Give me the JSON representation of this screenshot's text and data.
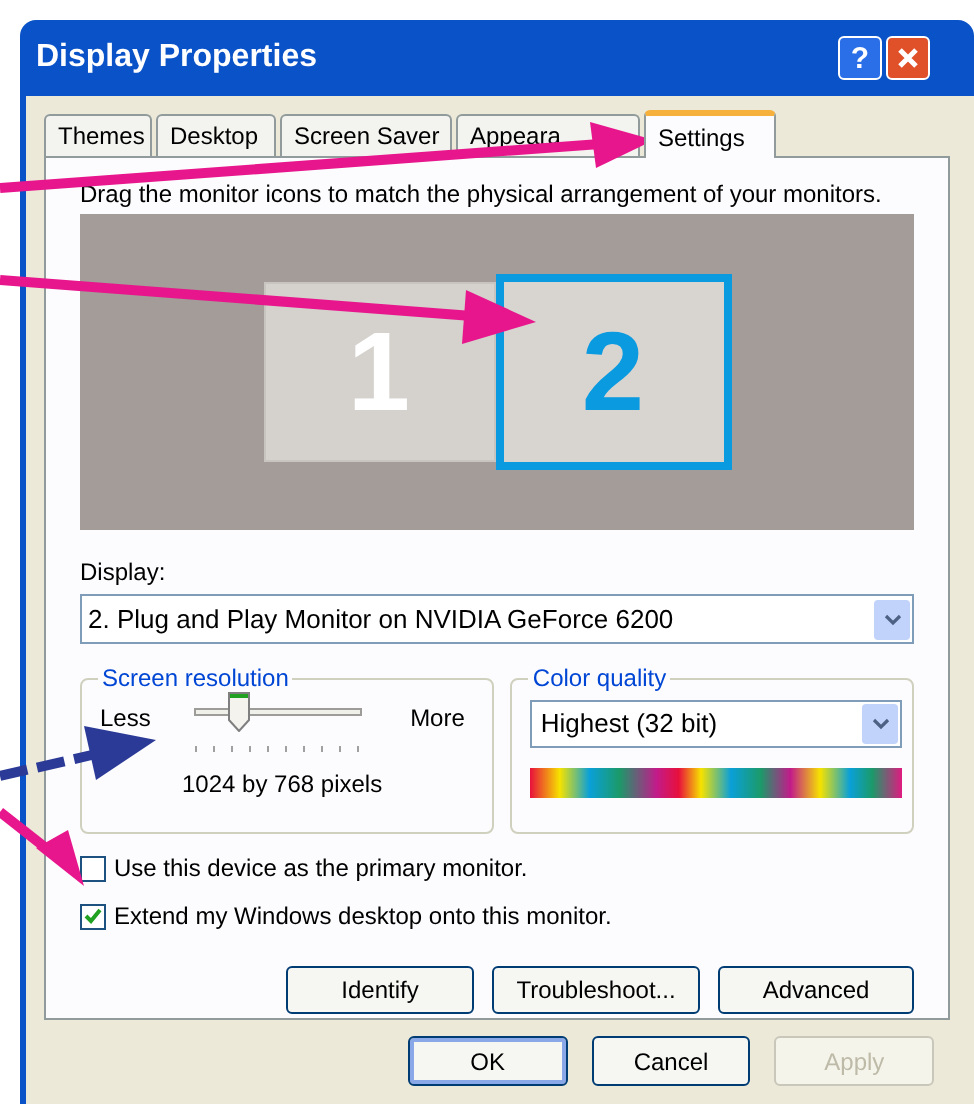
{
  "window": {
    "title": "Display Properties",
    "help_button": "?"
  },
  "tabs": [
    {
      "label": "Themes",
      "selected": false
    },
    {
      "label": "Desktop",
      "selected": false
    },
    {
      "label": "Screen Saver",
      "selected": false
    },
    {
      "label": "Appeara",
      "selected": false
    },
    {
      "label": "Settings",
      "selected": true
    }
  ],
  "instruction": "Drag the monitor icons to match the physical arrangement of your monitors.",
  "monitors": [
    {
      "label": "1",
      "selected": false
    },
    {
      "label": "2",
      "selected": true
    }
  ],
  "display": {
    "label": "Display:",
    "value": "2. Plug and Play Monitor on NVIDIA GeForce 6200"
  },
  "screen_resolution": {
    "title": "Screen resolution",
    "min_label": "Less",
    "max_label": "More",
    "level": 0.27,
    "reading": "1024 by 768 pixels"
  },
  "color_quality": {
    "title": "Color quality",
    "value": "Highest (32 bit)"
  },
  "checkboxes": [
    {
      "label": "Use this device as the primary monitor.",
      "checked": false
    },
    {
      "label": "Extend my Windows desktop onto this monitor.",
      "checked": true
    }
  ],
  "panel_buttons": [
    "Identify",
    "Troubleshoot...",
    "Advanced"
  ],
  "dialog_buttons": [
    {
      "label": "OK",
      "disabled": false,
      "default": true
    },
    {
      "label": "Cancel",
      "disabled": false,
      "default": false
    },
    {
      "label": "Apply",
      "disabled": true,
      "default": false
    }
  ],
  "annotation_arrows": [
    {
      "color": "#e8168c"
    },
    {
      "color": "#e8168c"
    },
    {
      "color": "#2b3a96"
    },
    {
      "color": "#e8168c"
    }
  ]
}
